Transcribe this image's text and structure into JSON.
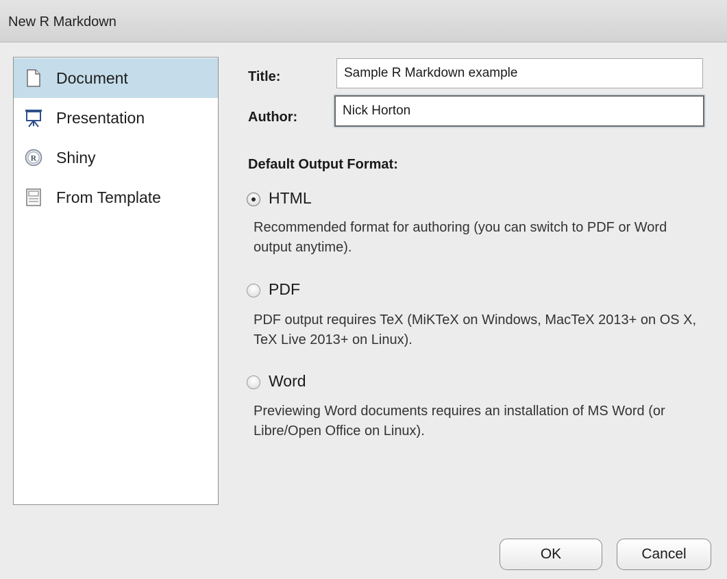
{
  "window": {
    "title": "New R Markdown"
  },
  "sidebar": {
    "items": [
      {
        "label": "Document",
        "icon": "document-icon",
        "selected": true
      },
      {
        "label": "Presentation",
        "icon": "presentation-icon",
        "selected": false
      },
      {
        "label": "Shiny",
        "icon": "shiny-r-icon",
        "selected": false
      },
      {
        "label": "From Template",
        "icon": "template-icon",
        "selected": false
      }
    ]
  },
  "form": {
    "title_label": "Title:",
    "title_value": "Sample R Markdown example",
    "author_label": "Author:",
    "author_value": "Nick Horton"
  },
  "output_format": {
    "heading": "Default Output Format:",
    "selected": "HTML",
    "options": [
      {
        "label": "HTML",
        "description": "Recommended format for authoring (you can switch to PDF or Word output anytime)."
      },
      {
        "label": "PDF",
        "description": "PDF output requires TeX (MiKTeX on Windows, MacTeX 2013+ on OS X, TeX Live 2013+ on Linux)."
      },
      {
        "label": "Word",
        "description": "Previewing Word documents requires an installation of MS Word (or Libre/Open Office on Linux)."
      }
    ]
  },
  "buttons": {
    "ok": "OK",
    "cancel": "Cancel"
  },
  "colors": {
    "selection": "#c5dcea",
    "background": "#ececec"
  }
}
